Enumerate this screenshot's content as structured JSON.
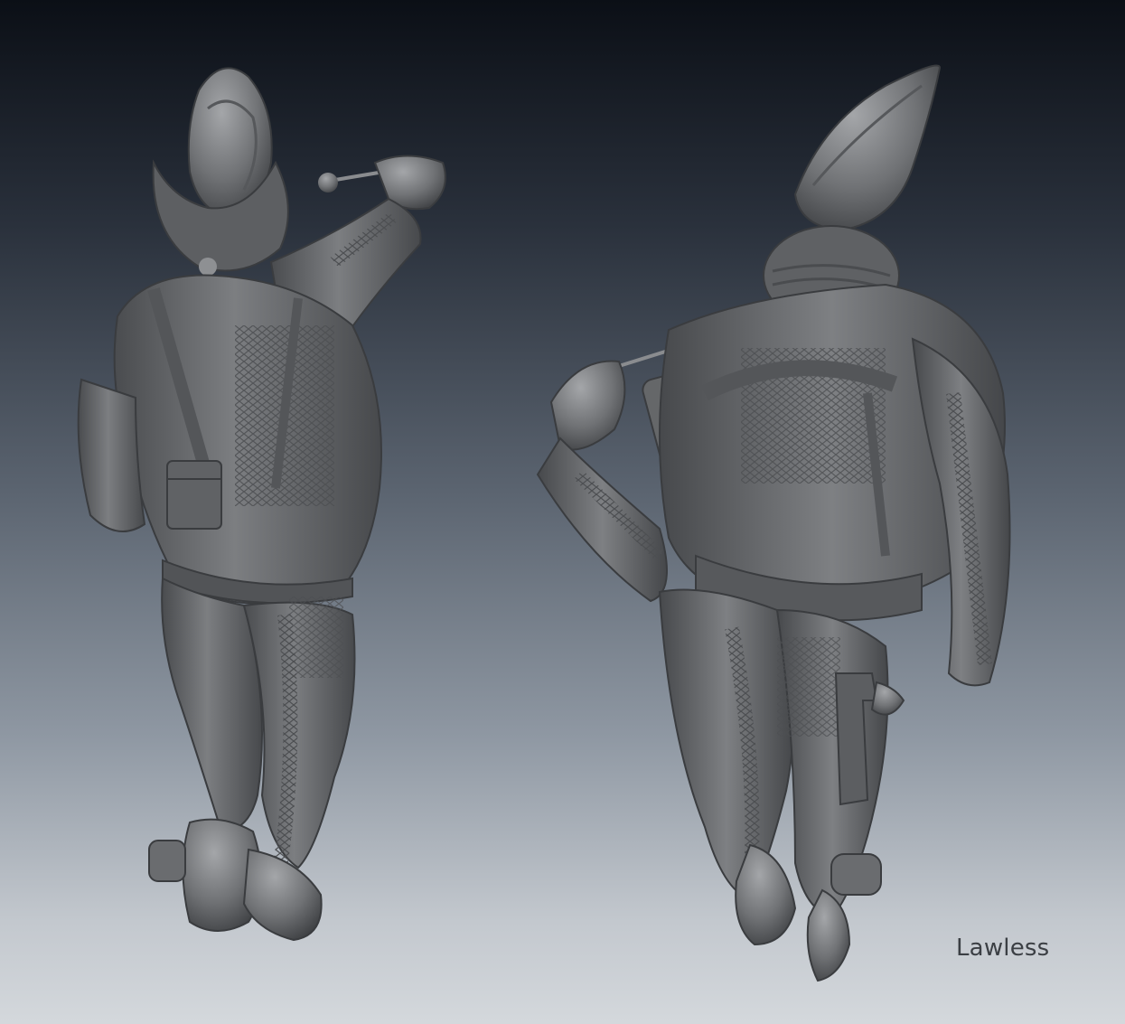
{
  "image": {
    "signature": "Lawless",
    "colors": {
      "background_top": "#0b0f16",
      "background_bottom": "#d4d8dc",
      "sculpt_base": "#6f7174",
      "sculpt_light": "#9a9c9f",
      "sculpt_dark": "#3c3e41",
      "signature_text": "#3b3f44"
    }
  }
}
